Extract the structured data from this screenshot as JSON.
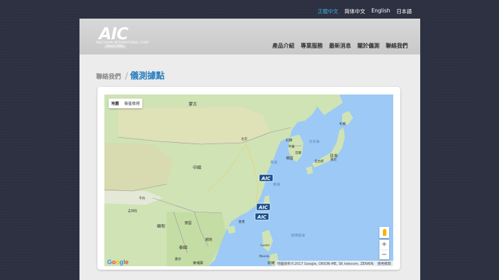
{
  "languages": [
    {
      "label": "正體中文",
      "active": true
    },
    {
      "label": "简体中文",
      "active": false
    },
    {
      "label": "English",
      "active": false
    },
    {
      "label": "日本語",
      "active": false
    }
  ],
  "logo": {
    "mark": "AIC",
    "sub": "PRECISION INTERNATIONAL CORP",
    "since": "Since 1981"
  },
  "nav": [
    "產品介紹",
    "專業服務",
    "最新消息",
    "關於儀測",
    "聯絡我們"
  ],
  "breadcrumb": {
    "parent": "聯絡我們",
    "separator": "/",
    "current": "儀測據點"
  },
  "map": {
    "type_controls": [
      "地圖",
      "衛星檢視"
    ],
    "labels": {
      "mongolia": "蒙古",
      "beijing": "北京",
      "north_korea": "北韓",
      "pyongyang": "平壤",
      "korea": "韓國",
      "seoul": "首爾",
      "tokyo": "東京",
      "japan": "日本",
      "sapporo": "札幌",
      "nagoya": "名古屋",
      "sea_of_japan": "日本海",
      "china": "中國",
      "yellow_sea": "黃海",
      "east_china_sea": "東海",
      "myanmar": "緬甸",
      "laos": "寮國",
      "thailand": "泰國",
      "vietnam": "越南",
      "bangkok": "曼谷",
      "cambodia": "柬埔寨",
      "hong_kong": "香港",
      "philippine_sea": "菲律賓海",
      "luzon": "Luzon",
      "manila": "Manila",
      "bhutan": "不丹",
      "bangladesh": "孟加拉",
      "philippines": "菲律賓"
    },
    "markers": [
      "AIC",
      "AIC",
      "AIC"
    ],
    "attribution": "地圖資料©2017 Google, ORION-ME, SK telecom, ZENRIN",
    "terms": "使用條款",
    "google": [
      "G",
      "o",
      "o",
      "g",
      "l",
      "e"
    ],
    "zoom_in": "+",
    "zoom_out": "−"
  },
  "colors": {
    "accent": "#3ea8e0",
    "title": "#2a7fbf",
    "water": "#9cc9f5",
    "land": "#cfe3b4"
  }
}
